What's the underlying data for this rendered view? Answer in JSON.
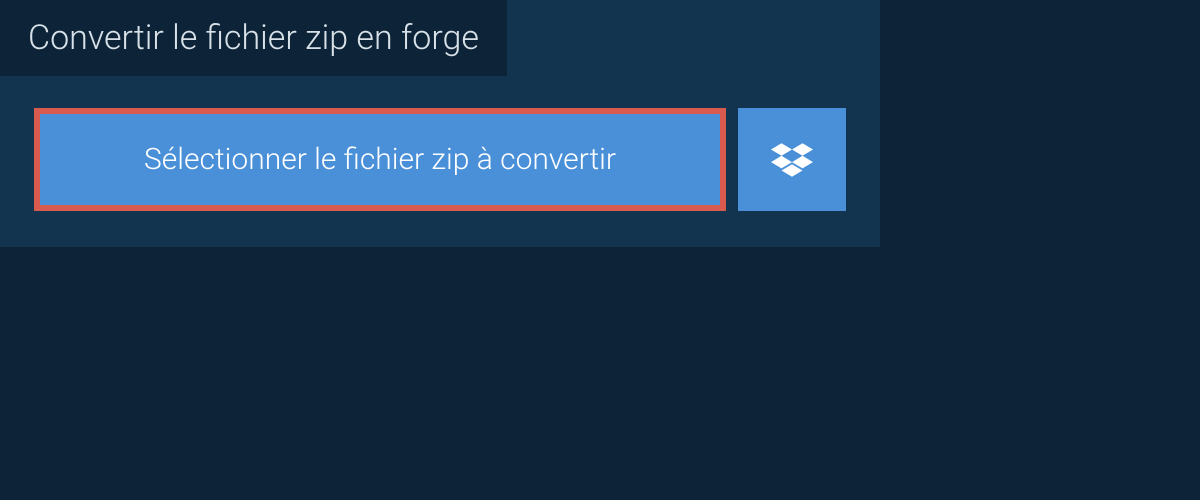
{
  "header": {
    "title": "Convertir le fichier zip en forge"
  },
  "buttons": {
    "select_file_label": "Sélectionner le fichier zip à convertir"
  },
  "colors": {
    "background": "#0d2438",
    "panel": "#12344f",
    "button": "#4a90d9",
    "highlight_border": "#d95b4f"
  }
}
